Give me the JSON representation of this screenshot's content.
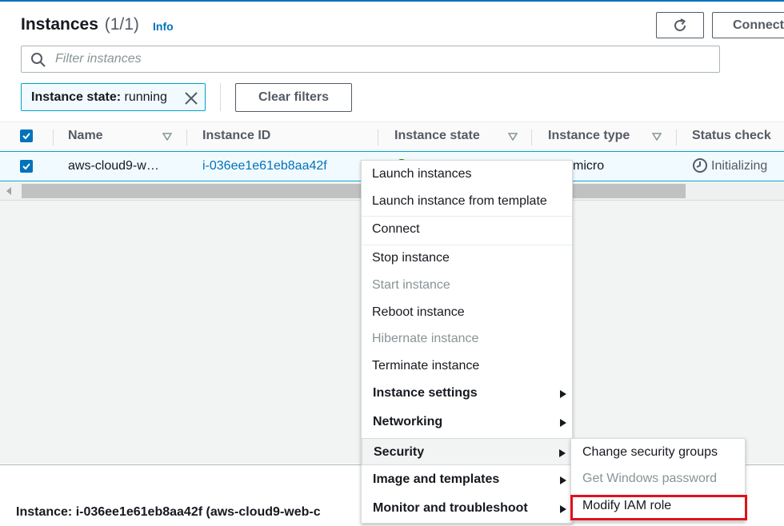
{
  "header": {
    "title": "Instances",
    "count": "(1/1)",
    "info_label": "Info",
    "connect_label": "Connect"
  },
  "search": {
    "placeholder": "Filter instances"
  },
  "filter_token": {
    "key": "Instance state:",
    "value": "running"
  },
  "clear_filters_label": "Clear filters",
  "table": {
    "columns": [
      "Name",
      "Instance ID",
      "Instance state",
      "Instance type",
      "Status check"
    ],
    "rows": [
      {
        "name": "aws-cloud9-w…",
        "instance_id": "i-036ee1e61eb8aa42f",
        "instance_type": "micro",
        "status_check": "Initializing"
      }
    ]
  },
  "context_menu": {
    "items": [
      {
        "label": "Launch instances",
        "disabled": false
      },
      {
        "label": "Launch instance from template",
        "disabled": false
      },
      {
        "label": "Connect",
        "disabled": false
      },
      {
        "label": "Stop instance",
        "disabled": false
      },
      {
        "label": "Start instance",
        "disabled": true
      },
      {
        "label": "Reboot instance",
        "disabled": false
      },
      {
        "label": "Hibernate instance",
        "disabled": true
      },
      {
        "label": "Terminate instance",
        "disabled": false
      },
      {
        "label": "Instance settings",
        "submenu": true
      },
      {
        "label": "Networking",
        "submenu": true
      },
      {
        "label": "Security",
        "submenu": true,
        "active": true
      },
      {
        "label": "Image and templates",
        "submenu": true
      },
      {
        "label": "Monitor and troubleshoot",
        "submenu": true
      }
    ]
  },
  "security_submenu": {
    "items": [
      {
        "label": "Change security groups",
        "disabled": false
      },
      {
        "label": "Get Windows password",
        "disabled": true
      },
      {
        "label": "Modify IAM role",
        "disabled": false,
        "highlighted": true
      }
    ]
  },
  "bottom_panel": {
    "title": "Instance: i-036ee1e61eb8aa42f (aws-cloud9-web-c"
  },
  "colors": {
    "accent": "#0073bb",
    "highlight": "#e1111b",
    "selected_row": "#f1faff",
    "running": "#1d8102"
  }
}
